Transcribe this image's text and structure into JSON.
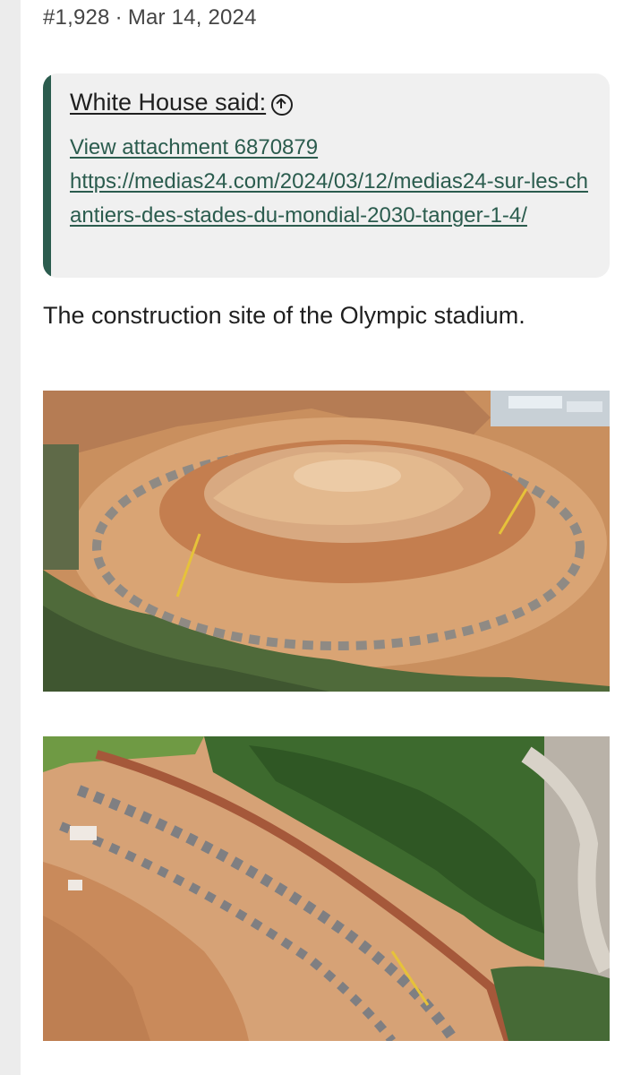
{
  "post": {
    "number": "#1,928",
    "separator": "·",
    "date": "Mar 14, 2024"
  },
  "quote": {
    "author_label": "White House said:",
    "attachment_link": "View attachment 6870879",
    "url": "https://medias24.com/2024/03/12/medias24-sur-les-chantiers-des-stades-du-mondial-2030-tanger-1-4/"
  },
  "body": {
    "text": "The construction site of the Olympic stadium."
  },
  "icons": {
    "quote_jump": "arrow-up-circle-icon"
  },
  "colors": {
    "accent": "#2b5c4e",
    "quote_bg": "#f0f0f0",
    "rail": "#ececec"
  }
}
